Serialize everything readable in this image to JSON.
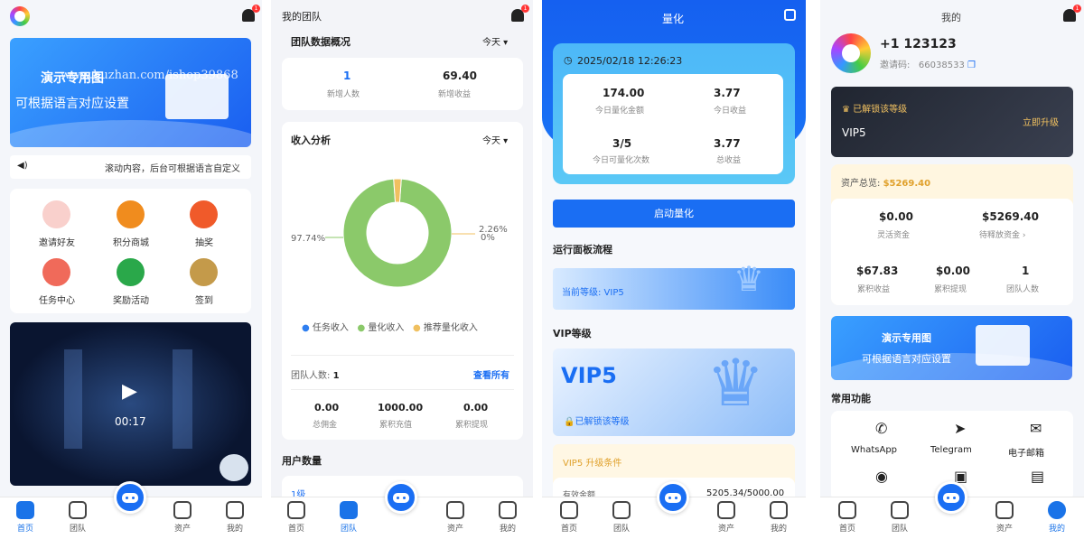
{
  "colors": {
    "accent": "#1a6ef3",
    "gold": "#e0a12c",
    "green": "#8bc96a",
    "orange": "#f0c060"
  },
  "nav": {
    "home": "首页",
    "team": "团队",
    "assets": "资产",
    "mine": "我的"
  },
  "p1": {
    "bell_badge": "1",
    "banner": {
      "line1": "演示专用图",
      "line2": "可根据语言对应设置",
      "watermark": "www.huzhan.com/ishop39868"
    },
    "marquee": "滚动内容，后台可根据语言自定义",
    "grid": [
      {
        "label": "邀请好友",
        "color": "#f5a2a0",
        "icon": "user-icon"
      },
      {
        "label": "积分商城",
        "color": "#f08c1e",
        "icon": "gift-icon"
      },
      {
        "label": "抽奖",
        "color": "#f05a2a",
        "icon": "wheel-icon"
      },
      {
        "label": "任务中心",
        "color": "#f06a5a",
        "icon": "list-icon"
      },
      {
        "label": "奖励活动",
        "color": "#2aa84a",
        "icon": "star-icon"
      },
      {
        "label": "签到",
        "color": "#c49a4a",
        "icon": "calendar-icon"
      }
    ],
    "video_time": "00:17"
  },
  "p2": {
    "title": "我的团队",
    "bell_badge": "1",
    "overview": {
      "title": "团队数据概况",
      "period": "今天",
      "stats": [
        {
          "value": "1",
          "label": "新增人数"
        },
        {
          "value": "69.40",
          "label": "新增收益"
        }
      ]
    },
    "income": {
      "title": "收入分析",
      "period": "今天",
      "left_label": "97.74%",
      "right_label1": "2.26%",
      "right_label2": "0%",
      "legend": [
        {
          "label": "任务收入",
          "color": "#2f7ff0"
        },
        {
          "label": "量化收入",
          "color": "#8bc96a"
        },
        {
          "label": "推荐量化收入",
          "color": "#f0c060"
        }
      ]
    },
    "team_count_label": "团队人数:",
    "team_count": "1",
    "view_all": "查看所有",
    "bottom_stats": [
      {
        "value": "0.00",
        "label": "总佣金"
      },
      {
        "value": "1000.00",
        "label": "累积充值"
      },
      {
        "value": "0.00",
        "label": "累积提现"
      }
    ],
    "user_data_title": "用户数量",
    "level1": "1级"
  },
  "chart_data": {
    "type": "pie",
    "categories": [
      "任务收入",
      "量化收入",
      "推荐量化收入"
    ],
    "values": [
      0,
      97.74,
      2.26
    ],
    "title": "收入分析",
    "legend": "bottom"
  },
  "p3": {
    "title": "量化",
    "datetime": "2025/02/18 12:26:23",
    "stats": [
      {
        "value": "174.00",
        "label": "今日量化金额"
      },
      {
        "value": "3.77",
        "label": "今日收益"
      },
      {
        "value": "3/5",
        "label": "今日可量化次数"
      },
      {
        "value": "3.77",
        "label": "总收益"
      }
    ],
    "start_button": "启动量化",
    "flow_title": "运行面板流程",
    "current_level": "当前等级: VIP5",
    "vip_title": "VIP等级",
    "vip_badge": "VIP5",
    "vip_unlocked": "已解锁该等级",
    "upgrade_title": "VIP5 升级条件",
    "valid_amount_label": "有效金额",
    "valid_amount": "5205.34/5000.00"
  },
  "p4": {
    "title": "我的",
    "bell_badge": "1",
    "phone": "+1 123123",
    "invite_label": "邀请码:",
    "invite_code": "66038533",
    "vip_unlocked": "已解锁该等级",
    "vip_level": "VIP5",
    "upgrade": "立即升级",
    "asset_label": "资产总览:",
    "asset_total": "$5269.40",
    "stats": [
      {
        "value": "$0.00",
        "label": "灵活资金"
      },
      {
        "value": "$5269.40",
        "label": "待释放资金 ›"
      },
      {
        "value": "$67.83",
        "label": "累积收益"
      },
      {
        "value": "$0.00",
        "label": "累积提现"
      },
      {
        "value": "1",
        "label": "团队人数"
      }
    ],
    "banner": {
      "line1": "演示专用图",
      "line2": "可根据语言对应设置"
    },
    "common_title": "常用功能",
    "functions": [
      {
        "label": "WhatsApp",
        "icon": "whatsapp-icon"
      },
      {
        "label": "Telegram",
        "icon": "telegram-icon"
      },
      {
        "label": "电子邮箱",
        "icon": "email-icon"
      }
    ]
  }
}
